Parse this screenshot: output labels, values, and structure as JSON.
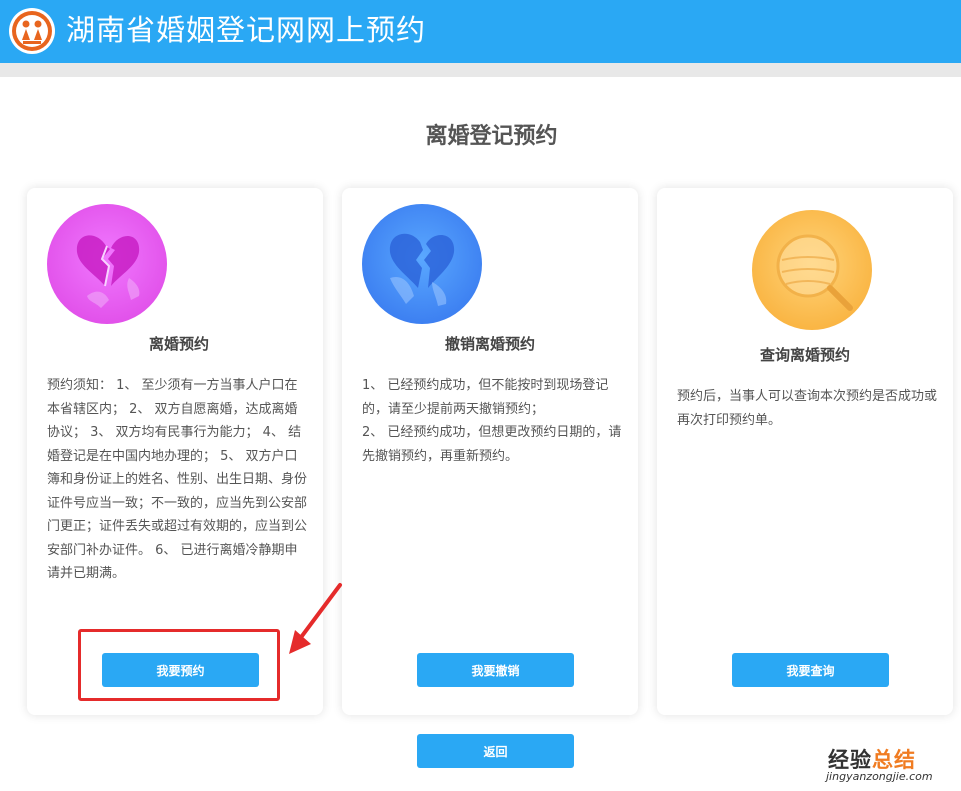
{
  "header": {
    "title": "湖南省婚姻登记网网上预约",
    "logo_icon": "marriage-registry-logo-icon",
    "bg_color": "#2aa8f4"
  },
  "page_title": "离婚登记预约",
  "cards": [
    {
      "icon": "broken-heart-icon",
      "title": "离婚预约",
      "description": "预约须知： 1、 至少须有一方当事人户口在本省辖区内； 2、 双方自愿离婚，达成离婚协议； 3、 双方均有民事行为能力； 4、 结婚登记是在中国内地办理的； 5、 双方户口簿和身份证上的姓名、性别、出生日期、身份证件号应当一致；不一致的，应当先到公安部门更正；证件丢失或超过有效期的，应当到公安部门补办证件。 6、 已进行离婚冷静期申请并已期满。",
      "button": "我要预约"
    },
    {
      "icon": "heart-mend-icon",
      "title": "撤销离婚预约",
      "description": "1、 已经预约成功，但不能按时到现场登记的，请至少提前两天撤销预约；\n2、 已经预约成功，但想更改预约日期的，请先撤销预约，再重新预约。",
      "button": "我要撤销"
    },
    {
      "icon": "magnifier-icon",
      "title": "查询离婚预约",
      "description": "预约后，当事人可以查询本次预约是否成功或再次打印预约单。",
      "button": "我要查询"
    }
  ],
  "return_button": "返回",
  "watermark": {
    "part1": "经验",
    "part2": "总结",
    "url": "jingyanzongjie.com"
  },
  "colors": {
    "accent": "#2aa8f4",
    "highlight": "#e52b2b",
    "watermark_orange": "#f07c22"
  }
}
